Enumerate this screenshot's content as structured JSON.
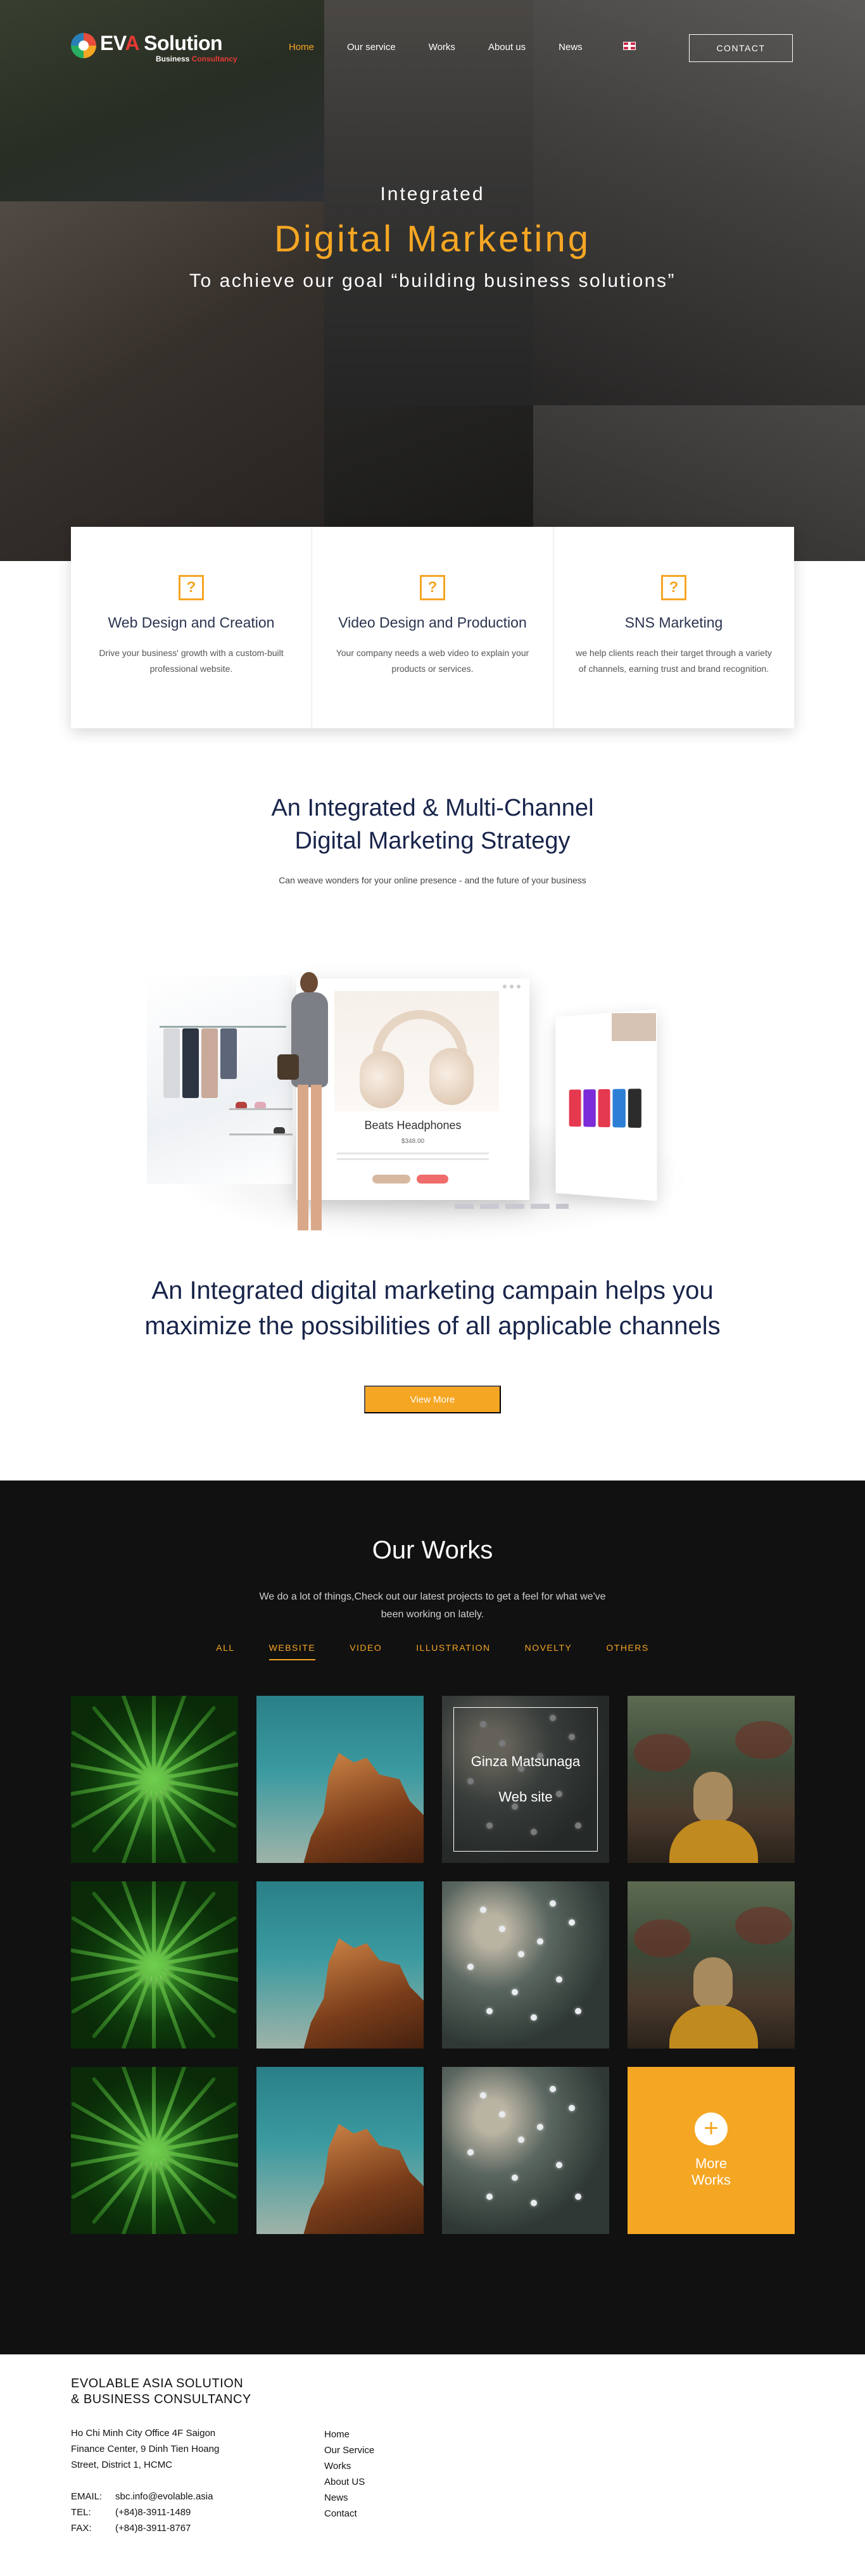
{
  "brand": {
    "logo_prefix": "EV",
    "logo_accent": "A",
    "logo_suffix": " Solution",
    "logo_sub_prefix": "Business",
    "logo_sub_accent": " Consultancy"
  },
  "nav": {
    "items": [
      {
        "label": "Home",
        "active": true
      },
      {
        "label": "Our service",
        "active": false
      },
      {
        "label": "Works",
        "active": false
      },
      {
        "label": "About us",
        "active": false
      },
      {
        "label": "News",
        "active": false
      }
    ],
    "language_flag": "uk-flag-icon",
    "contact_label": "CONTACT"
  },
  "hero": {
    "kicker": "Integrated",
    "title": "Digital Marketing",
    "subtitle": "To achieve our goal “building business solutions”"
  },
  "services": [
    {
      "icon": "question-box-icon",
      "glyph": "?",
      "title": "Web Design and Creation",
      "desc": "Drive your business' growth with a custom-built professional website."
    },
    {
      "icon": "question-box-icon",
      "glyph": "?",
      "title": "Video Design and Production",
      "desc": "Your company needs a web video to explain your products or services."
    },
    {
      "icon": "question-box-icon",
      "glyph": "?",
      "title": "SNS Marketing",
      "desc": "we help clients reach their target through a variety of channels, earning trust and brand recognition."
    }
  ],
  "strategy": {
    "title_line1": "An Integrated & Multi-Channel",
    "title_line2": "Digital Marketing Strategy",
    "tagline": "Can weave wonders for your online presence - and the future of your business"
  },
  "showcase": {
    "product_name": "Beats Headphones",
    "product_price": "$348.00"
  },
  "campaign": {
    "line1": "An Integrated digital marketing campain helps you",
    "line2": "maximize the possibilities of all applicable channels",
    "button_label": "View More"
  },
  "works": {
    "title": "Our Works",
    "intro": "We do a lot of things,Check out our latest projects to get a feel for what we've been working on lately.",
    "filters": [
      {
        "label": "ALL",
        "active": false
      },
      {
        "label": "WEBSITE",
        "active": true
      },
      {
        "label": "VIDEO",
        "active": false
      },
      {
        "label": "ILLUSTRATION",
        "active": false
      },
      {
        "label": "NOVELTY",
        "active": false
      },
      {
        "label": "OTHERS",
        "active": false
      }
    ],
    "featured_title": "Ginza Matsunaga",
    "featured_category": "Web site",
    "more_label": "More Works",
    "more_plus": "+"
  },
  "footer": {
    "company": "EVOLABLE ASIA SOLUTION & BUSINESS CONSULTANCY",
    "address": "Ho Chi Minh City Office 4F Saigon Finance Center, 9 Dinh Tien Hoang Street, District 1, HCMC",
    "email_label": "EMAIL:",
    "email": "sbc.info@evolable.asia",
    "tel_label": "TEL:",
    "tel": "(+84)8-3911-1489",
    "fax_label": "FAX:",
    "fax": "(+84)8-3911-8767",
    "links": [
      "Home",
      "Our Service",
      "Works",
      "About US",
      "News",
      "Contact"
    ]
  },
  "colors": {
    "accent": "#f5a623",
    "navy": "#18244a",
    "dark": "#111111"
  }
}
